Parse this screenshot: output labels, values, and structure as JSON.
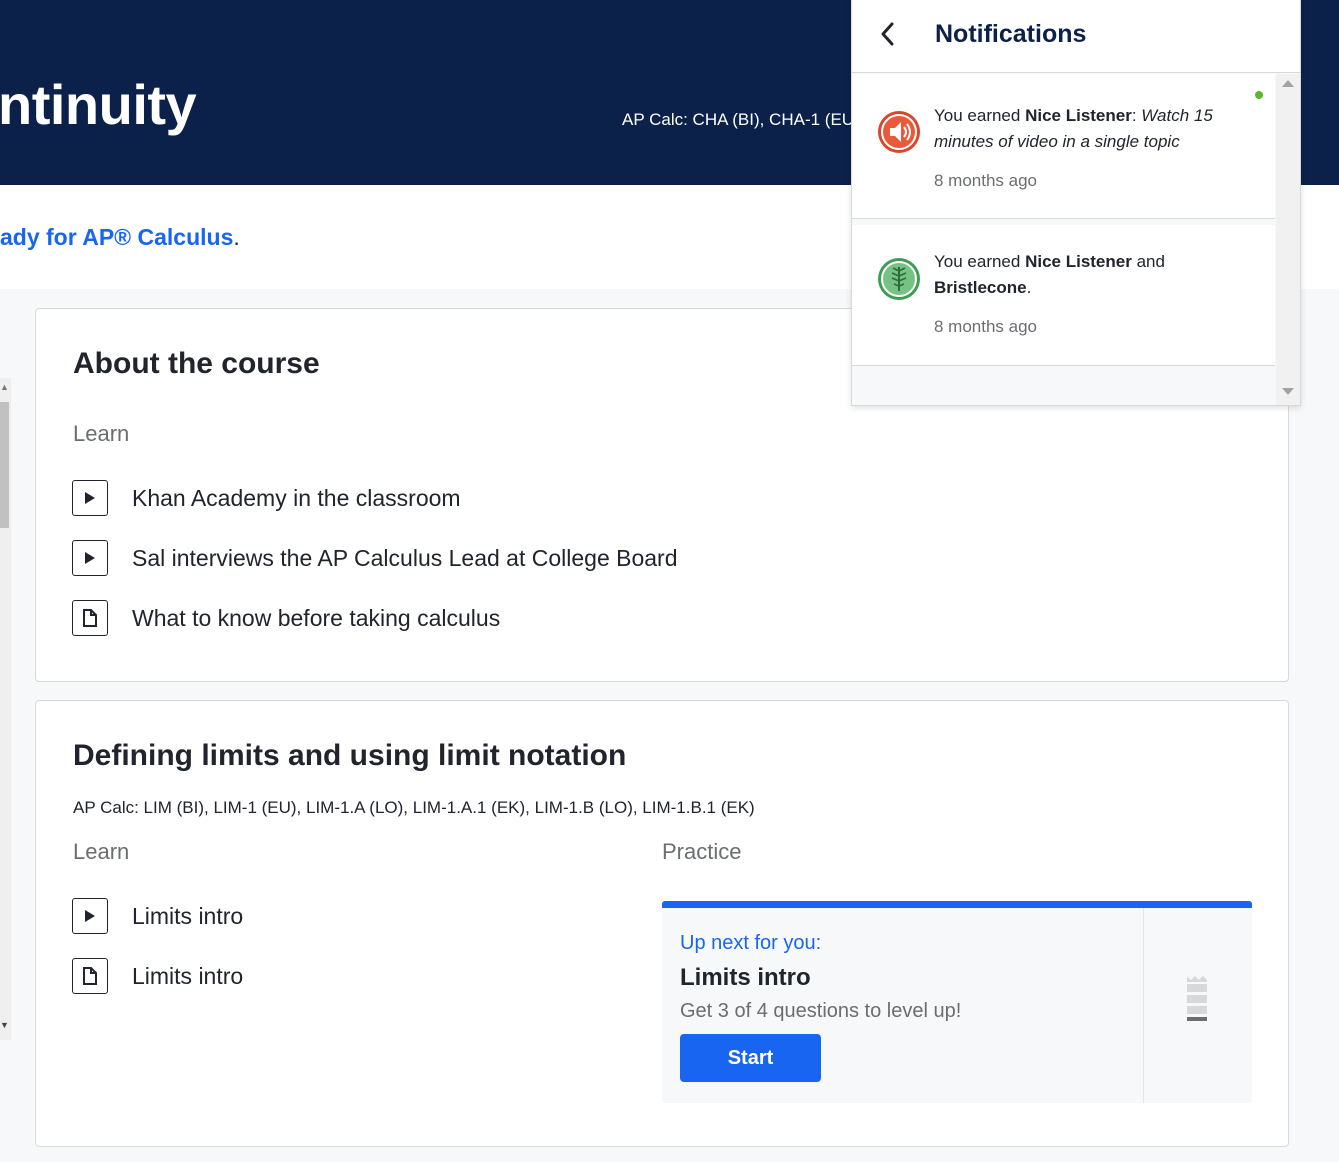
{
  "hero": {
    "title": "ntinuity",
    "tags": "AP Calc: CHA (BI), CHA-1 (EU"
  },
  "intro": {
    "link_text": "ady for AP® Calculus",
    "trailing": "."
  },
  "about_course": {
    "title": "About the course",
    "learn_label": "Learn",
    "items": [
      {
        "icon": "video-play-icon",
        "label": "Khan Academy in the classroom"
      },
      {
        "icon": "video-play-icon",
        "label": "Sal interviews the AP Calculus Lead at College Board"
      },
      {
        "icon": "article-icon",
        "label": "What to know before taking calculus"
      }
    ]
  },
  "limits_unit": {
    "title": "Defining limits and using limit notation",
    "tags": "AP Calc: LIM (BI), LIM-1 (EU), LIM-1.A (LO), LIM-1.A.1 (EK), LIM-1.B (LO), LIM-1.B.1 (EK)",
    "learn_label": "Learn",
    "practice_label": "Practice",
    "items": [
      {
        "icon": "video-play-icon",
        "label": "Limits intro"
      },
      {
        "icon": "article-icon",
        "label": "Limits intro"
      }
    ],
    "up_next": {
      "label": "Up next for you:",
      "title": "Limits intro",
      "description": "Get 3 of 4 questions to level up!",
      "button": "Start",
      "level_icon": "skill-level-tower-icon"
    }
  },
  "notifications": {
    "title": "Notifications",
    "back_icon": "chevron-left-icon",
    "items": [
      {
        "badge_icon": "speaker-badge-icon",
        "prefix": "You earned ",
        "badge_name": "Nice Listener",
        "separator": ": ",
        "detail": "Watch 15 minutes of video in a single topic",
        "time": "8 months ago",
        "unread": true
      },
      {
        "badge_icon": "bristlecone-badge-icon",
        "prefix": "You earned ",
        "badge_name": "Nice Listener",
        "conjunction": " and ",
        "badge_name_2": "Bristlecone",
        "suffix": ".",
        "time": "8 months ago",
        "unread": false
      }
    ]
  },
  "colors": {
    "hero_bg": "#0b2149",
    "accent_blue": "#1865f2",
    "unread_dot": "#5cb82e"
  }
}
